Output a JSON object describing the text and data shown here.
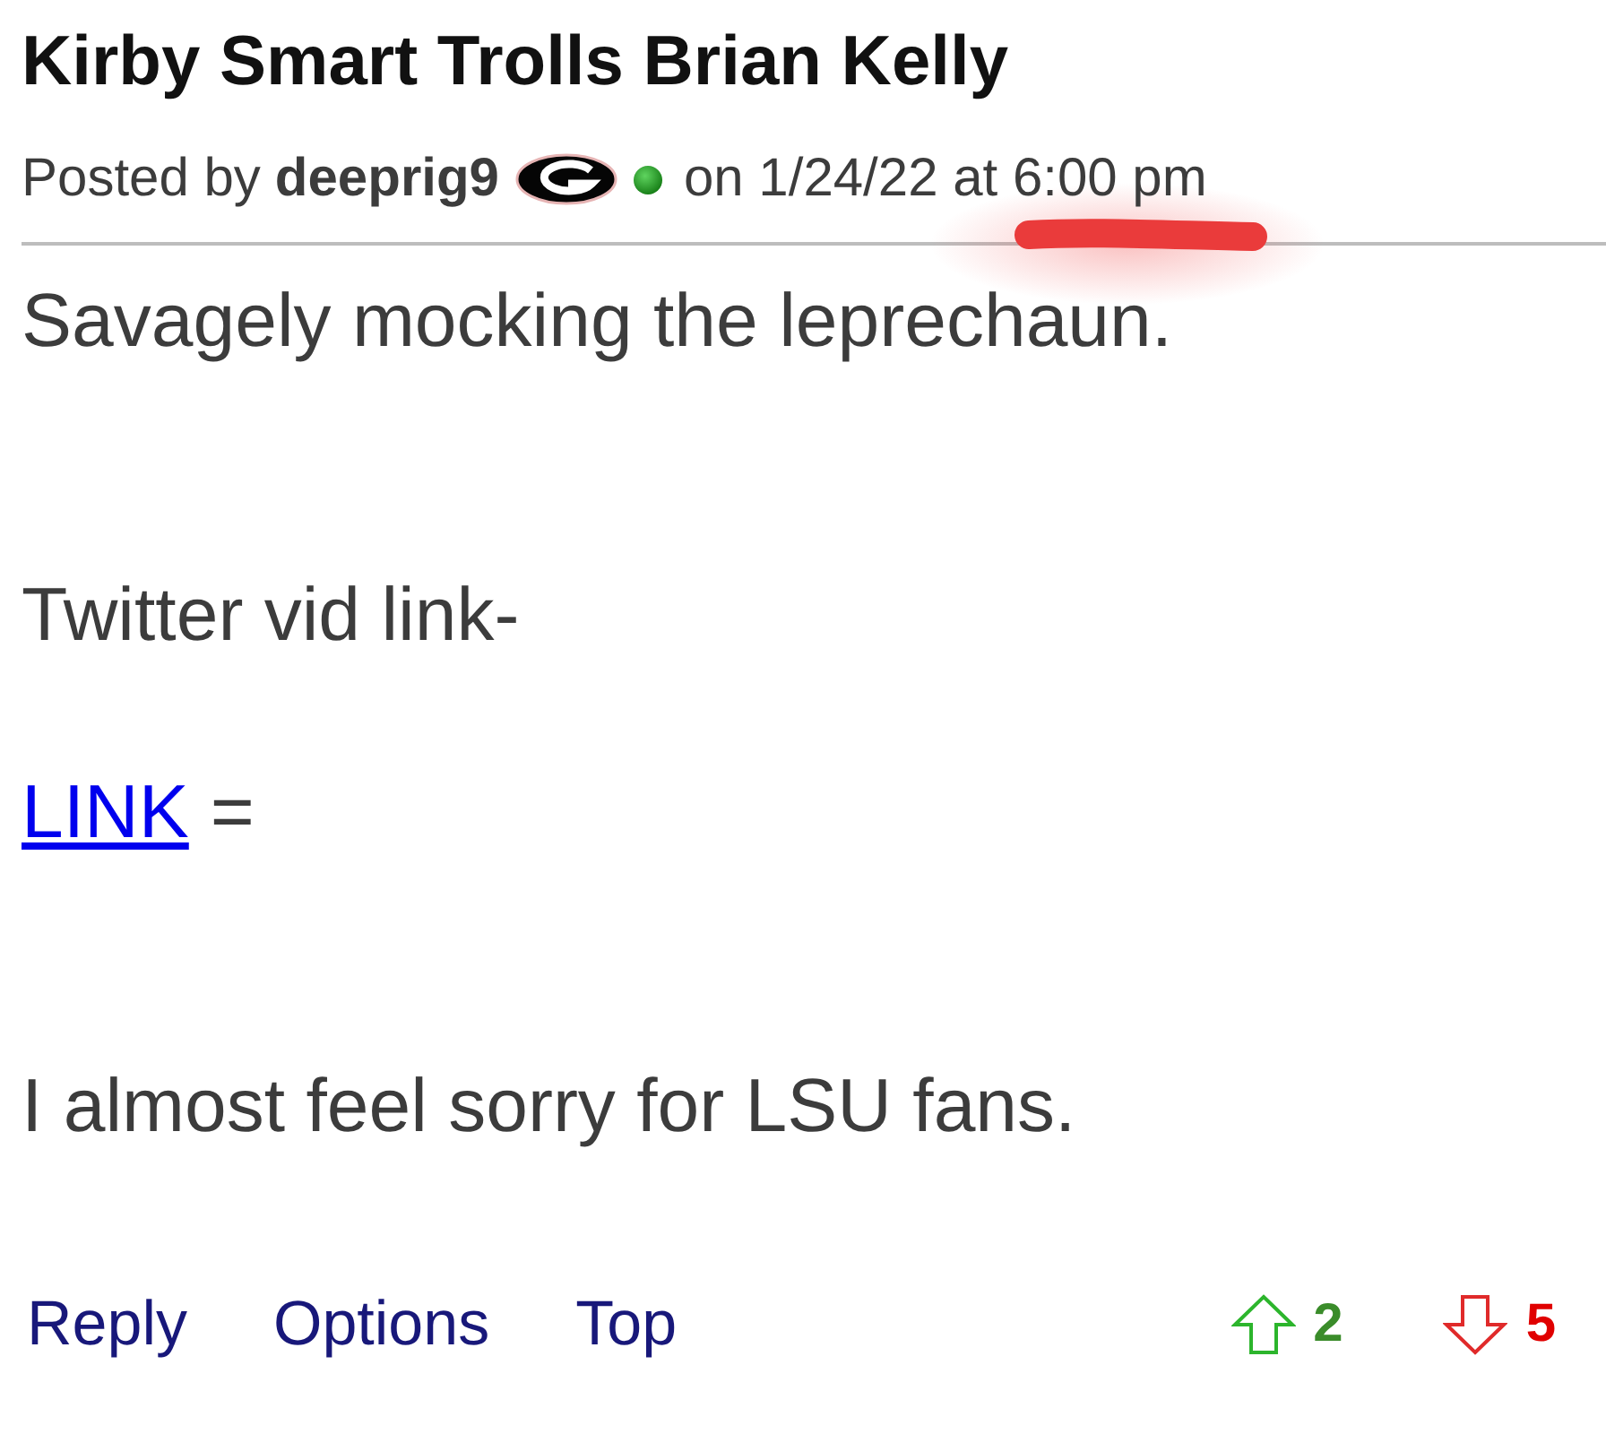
{
  "post": {
    "title": "Kirby Smart Trolls Brian Kelly",
    "byline": {
      "prefix": "Posted by",
      "author": "deeprig9",
      "online": true,
      "date": "on 1/24/22 at 6:00 pm"
    },
    "body": [
      {
        "kind": "text",
        "text": "Savagely mocking the leprechaun."
      },
      {
        "kind": "blank"
      },
      {
        "kind": "blank"
      },
      {
        "kind": "text",
        "text": "Twitter vid link-"
      },
      {
        "kind": "blank"
      },
      {
        "kind": "link",
        "link": "LINK",
        "text": "="
      },
      {
        "kind": "blank"
      },
      {
        "kind": "blank"
      },
      {
        "kind": "text",
        "text": "I almost feel sorry for LSU fans."
      }
    ],
    "actions": [
      "Reply",
      "Options",
      "Top"
    ],
    "votes": [
      {
        "kind": "up",
        "count": "2"
      },
      {
        "kind": "down",
        "count": "5"
      }
    ]
  }
}
